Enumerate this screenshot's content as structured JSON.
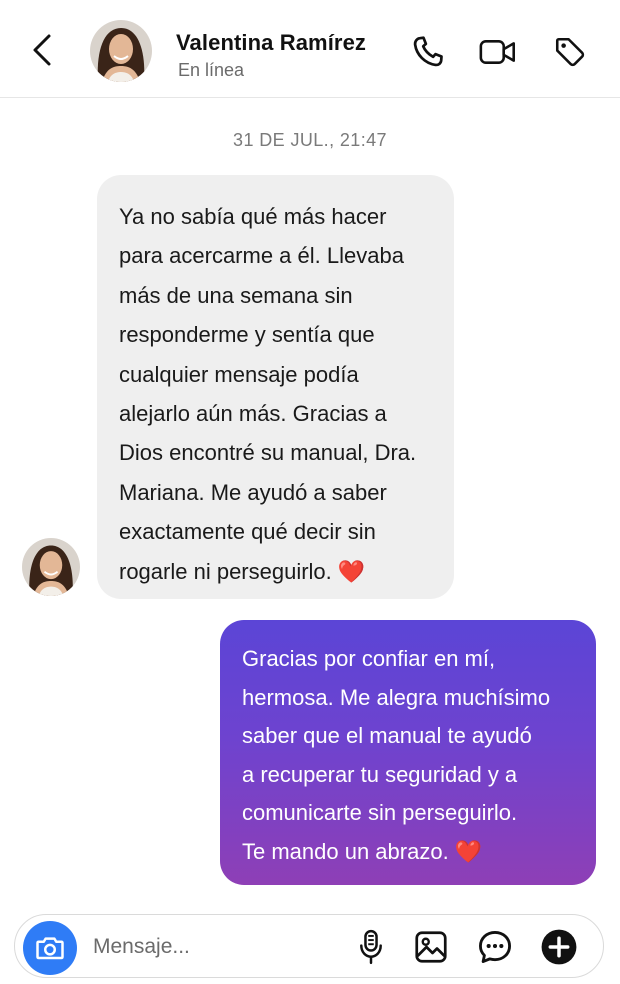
{
  "header": {
    "back_icon": "chevron-left-icon",
    "contact_name": "Valentina Ramírez",
    "status": "En línea",
    "icons": [
      "phone-icon",
      "video-camera-icon",
      "tag-icon"
    ]
  },
  "conversation": {
    "timestamp": "31 DE JUL., 21:47",
    "messages": [
      {
        "direction": "incoming",
        "text": "Ya no sabía qué más hacer\npara acercarme a él. Llevaba\nmás de una semana sin\nresponderme y sentía que\ncualquier mensaje podía\nalejarlo aún más. Gracias a\nDios encontré su manual, Dra.\nMariana. Me ayudó a saber\nexactamente qué decir sin\nrogarle ni perseguirlo. ❤️"
      },
      {
        "direction": "outgoing",
        "text": "Gracias por confiar en mí,\nhermosa. Me alegra muchísimo\nsaber que el manual te ayudó\na recuperar tu seguridad y a\ncomunicarte sin perseguirlo.\nTe mando un abrazo. ❤️"
      }
    ]
  },
  "composer": {
    "placeholder": "Mensaje...",
    "value": "",
    "icons": [
      "camera-icon",
      "microphone-icon",
      "gallery-icon",
      "sticker-icon",
      "plus-icon"
    ]
  },
  "colors": {
    "incoming_bubble": "#efefef",
    "outgoing_gradient_top": "#5b45d6",
    "outgoing_gradient_bottom": "#8e3fb6",
    "camera_button": "#2f7cf6"
  }
}
